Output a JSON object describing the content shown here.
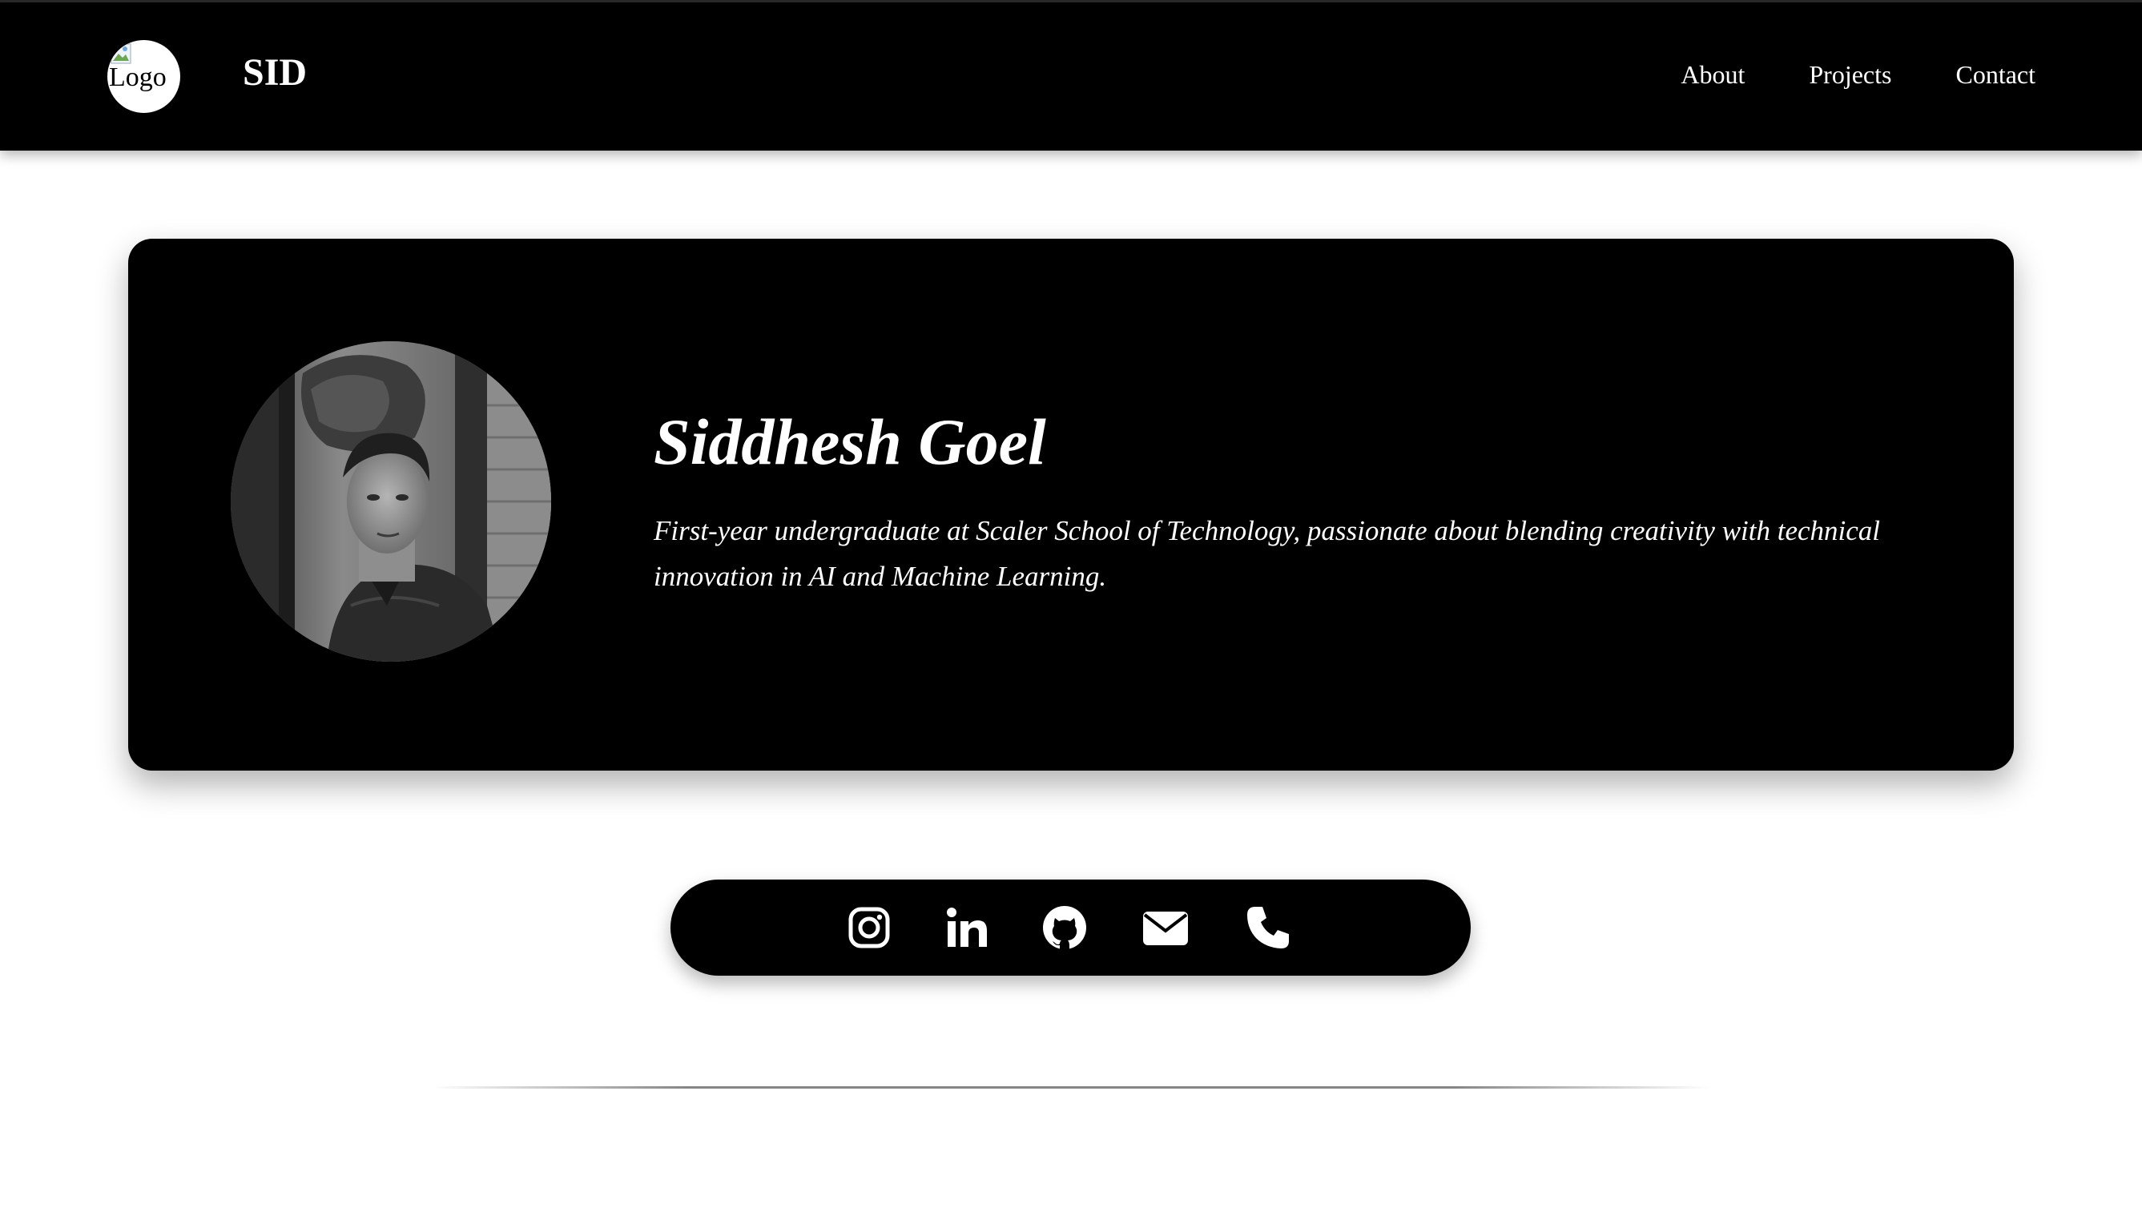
{
  "navbar": {
    "logo_alt": "Logo",
    "brand": "SID",
    "links": [
      {
        "label": "About"
      },
      {
        "label": "Projects"
      },
      {
        "label": "Contact"
      }
    ]
  },
  "hero": {
    "name": "Siddhesh Goel",
    "bio": "First-year undergraduate at Scaler School of Technology, passionate about blending creativity with technical innovation in AI and Machine Learning."
  },
  "social": {
    "icons": [
      "instagram-icon",
      "linkedin-icon",
      "github-icon",
      "email-icon",
      "phone-icon"
    ]
  },
  "colors": {
    "navbar_bg": "#000000",
    "card_bg": "#000000",
    "page_bg": "#ffffff",
    "text_on_dark": "#ffffff"
  }
}
